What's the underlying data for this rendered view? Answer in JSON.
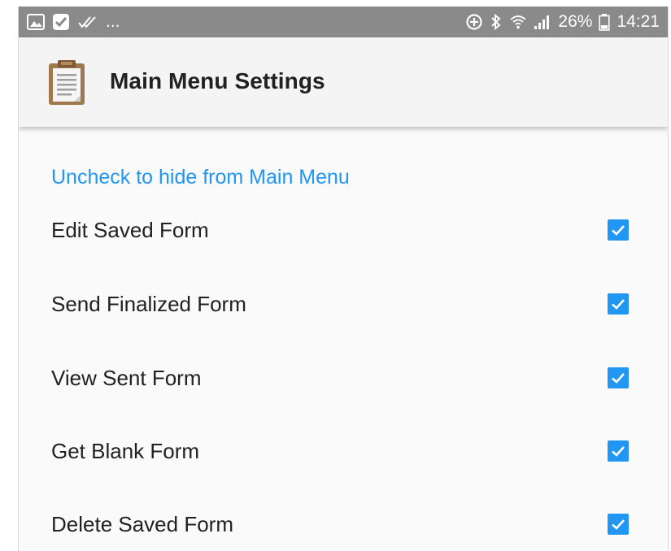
{
  "status_bar": {
    "left_icons": [
      "image-icon",
      "shield-check-icon",
      "double-check-icon"
    ],
    "overflow": "...",
    "right_icons": [
      "data-saver-icon",
      "bluetooth-icon",
      "wifi-icon",
      "signal-icon"
    ],
    "battery_percent": "26%",
    "time": "14:21"
  },
  "app_bar": {
    "icon": "clipboard-icon",
    "title": "Main Menu Settings"
  },
  "preferences": {
    "category_title": "Uncheck to hide from Main Menu",
    "items": [
      {
        "label": "Edit Saved Form",
        "checked": true
      },
      {
        "label": "Send Finalized Form",
        "checked": true
      },
      {
        "label": "View Sent Form",
        "checked": true
      },
      {
        "label": "Get Blank Form",
        "checked": true
      },
      {
        "label": "Delete Saved Form",
        "checked": true
      }
    ]
  },
  "colors": {
    "accent": "#2196f3",
    "status_bar_bg": "#8a8a8a",
    "app_bar_bg": "#f4f4f4",
    "background": "#fafafa",
    "text_primary": "#212121"
  }
}
